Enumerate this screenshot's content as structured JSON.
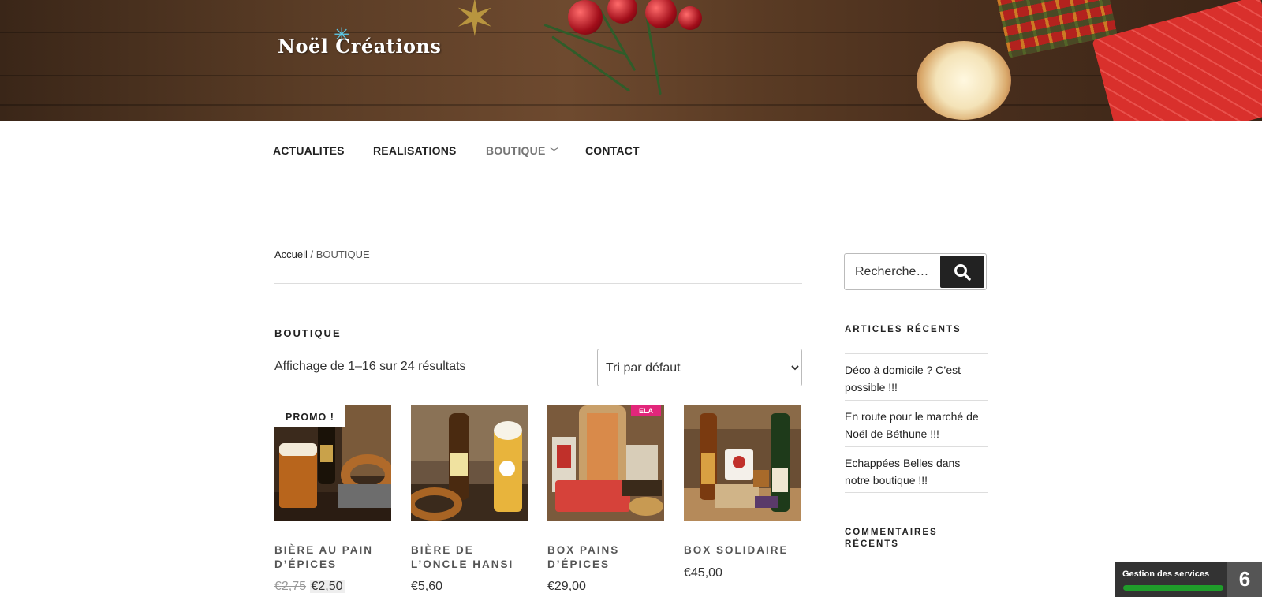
{
  "site": {
    "logo_text": "Noël Créations"
  },
  "nav": {
    "items": [
      {
        "label": "ACTUALITES"
      },
      {
        "label": "REALISATIONS"
      },
      {
        "label": "BOUTIQUE"
      },
      {
        "label": "CONTACT"
      }
    ]
  },
  "breadcrumb": {
    "home": "Accueil",
    "separator": " / ",
    "current": "BOUTIQUE"
  },
  "shop": {
    "title": "BOUTIQUE",
    "result_count": "Affichage de 1–16 sur 24 résultats",
    "sort_selected": "Tri par défaut"
  },
  "products": [
    {
      "name": "BIÈRE AU PAIN D’ÉPICES",
      "price_old": "€2,75",
      "price": "€2,50",
      "badge": "PROMO !"
    },
    {
      "name": "BIÈRE DE L’ONCLE HANSI",
      "price": "€5,60"
    },
    {
      "name": "BOX PAINS D’ÉPICES",
      "price": "€29,00",
      "badge": "ELA"
    },
    {
      "name": "BOX SOLIDAIRE",
      "price": "€45,00"
    }
  ],
  "sidebar": {
    "search_placeholder": "Recherche…",
    "recent_articles_title": "ARTICLES RÉCENTS",
    "recent_articles": [
      "Déco à domicile ? C’est possible !!!",
      "En route pour le marché de Noël de Béthune !!!",
      "Echappées Belles dans notre boutique !!!"
    ],
    "recent_comments_title": "COMMENTAIRES RÉCENTS"
  },
  "services_widget": {
    "label": "Gestion des services",
    "count": "6",
    "bar_color": "#1f9d2a"
  },
  "icons": {
    "search": "search-icon",
    "chevron": "chevron-down-icon"
  }
}
